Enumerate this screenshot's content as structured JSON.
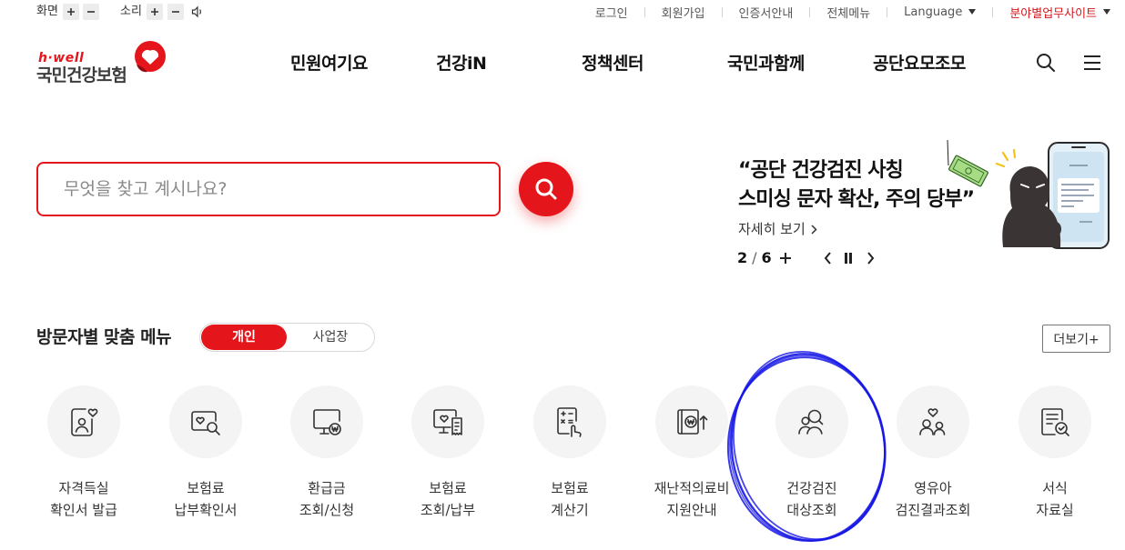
{
  "utility": {
    "screen_label": "화면",
    "sound_label": "소리",
    "links": [
      "로그인",
      "회원가입",
      "인증서안내",
      "전체메뉴"
    ],
    "language": "Language",
    "field_sites": "분야별업무사이트"
  },
  "header": {
    "logo_sub": "h·well",
    "logo_main": "국민건강보험",
    "nav": [
      "민원여기요",
      "건강iN",
      "정책센터",
      "국민과함께",
      "공단요모조모"
    ]
  },
  "search": {
    "placeholder": "무엇을 찾고 계시나요?"
  },
  "banner": {
    "title_line1": "“공단 건강검진 사칭",
    "title_line2": "스미싱 문자 확산, 주의 당부”",
    "more": "자세히 보기",
    "pager": {
      "current": "2",
      "separator": "/",
      "total": "6"
    }
  },
  "menu": {
    "title": "방문자별 맞춤 메뉴",
    "tabs": [
      {
        "label": "개인",
        "active": true
      },
      {
        "label": "사업장",
        "active": false
      }
    ],
    "more": "더보기+",
    "items": [
      {
        "line1": "자격득실",
        "line2": "확인서 발급",
        "icon": "id-card-heart-icon"
      },
      {
        "line1": "보험료",
        "line2": "납부확인서",
        "icon": "card-heart-search-icon"
      },
      {
        "line1": "환급금",
        "line2": "조회/신청",
        "icon": "monitor-won-icon"
      },
      {
        "line1": "보험료",
        "line2": "조회/납부",
        "icon": "monitor-heart-receipt-icon"
      },
      {
        "line1": "보험료",
        "line2": "계산기",
        "icon": "calculator-hand-icon"
      },
      {
        "line1": "재난적의료비",
        "line2": "지원안내",
        "icon": "document-won-arrow-icon"
      },
      {
        "line1": "건강검진",
        "line2": "대상조회",
        "icon": "people-search-icon"
      },
      {
        "line1": "영유아",
        "line2": "검진결과조회",
        "icon": "parent-child-heart-icon"
      },
      {
        "line1": "서식",
        "line2": "자료실",
        "icon": "form-document-check-icon"
      }
    ]
  },
  "colors": {
    "brand_red": "#e4161b",
    "field_sites_red": "#d3191e",
    "icon_circle_bg": "#f4f4f4",
    "annotation_blue": "#1717e6"
  }
}
